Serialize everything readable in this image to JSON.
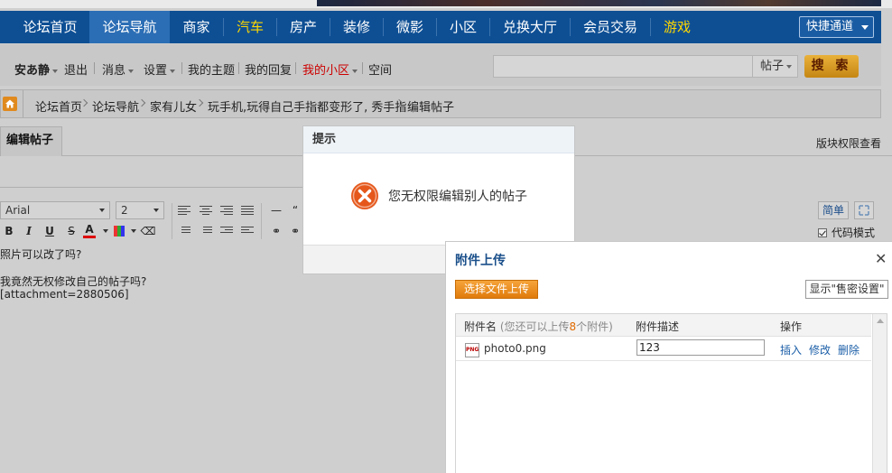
{
  "main_nav": {
    "items": [
      {
        "label": "论坛首页"
      },
      {
        "label": "论坛导航"
      },
      {
        "label": "商家"
      },
      {
        "label": "汽车"
      },
      {
        "label": "房产"
      },
      {
        "label": "装修"
      },
      {
        "label": "微影"
      },
      {
        "label": "小区"
      },
      {
        "label": "兑换大厅"
      },
      {
        "label": "会员交易"
      },
      {
        "label": "游戏"
      }
    ],
    "active": "论坛导航",
    "quick_access": "快捷通道"
  },
  "user_bar": {
    "username": "安あ静",
    "logout": "退出",
    "messages": "消息",
    "settings": "设置",
    "my_topics": "我的主题",
    "my_replies": "我的回复",
    "my_community": "我的小区",
    "space": "空间",
    "search_scope": "帖子",
    "search_button": "搜 索"
  },
  "breadcrumb": [
    "论坛首页",
    "论坛导航",
    "家有儿女",
    "玩手机,玩得自己手指都变形了, 秀手指",
    "编辑帖子"
  ],
  "editor": {
    "tab_label": "编辑帖子",
    "permission_link": "版块权限查看",
    "font_family": "Arial",
    "font_size": "2",
    "simple_button": "简单",
    "code_mode_label": "代码模式",
    "code_mode_checked": true,
    "content_lines": [
      "照片可以改了吗?",
      "我竟然无权修改自己的帖子吗?",
      "[attachment=2880506]"
    ]
  },
  "alert": {
    "title": "提示",
    "message": "您无权限编辑别人的帖子",
    "icon": "error-icon"
  },
  "upload_panel": {
    "title": "附件上传",
    "choose_button": "选择文件上传",
    "show_button": "显示\"售密设置\"",
    "col_name": "附件名",
    "col_note_prefix": "(您还可以上传",
    "col_note_count": "8",
    "col_note_suffix": "个附件)",
    "col_desc": "附件描述",
    "col_action": "操作",
    "files": [
      {
        "name": "photo0.png",
        "description": "123",
        "insert": "插入",
        "edit": "修改",
        "delete": "删除"
      }
    ]
  },
  "colors": {
    "nav_bg": "#0e4f94",
    "nav_active": "#2c6eb5",
    "nav_highlight": "#ffd800",
    "accent_orange": "#e07b0c",
    "link_blue": "#1c5fa8"
  }
}
